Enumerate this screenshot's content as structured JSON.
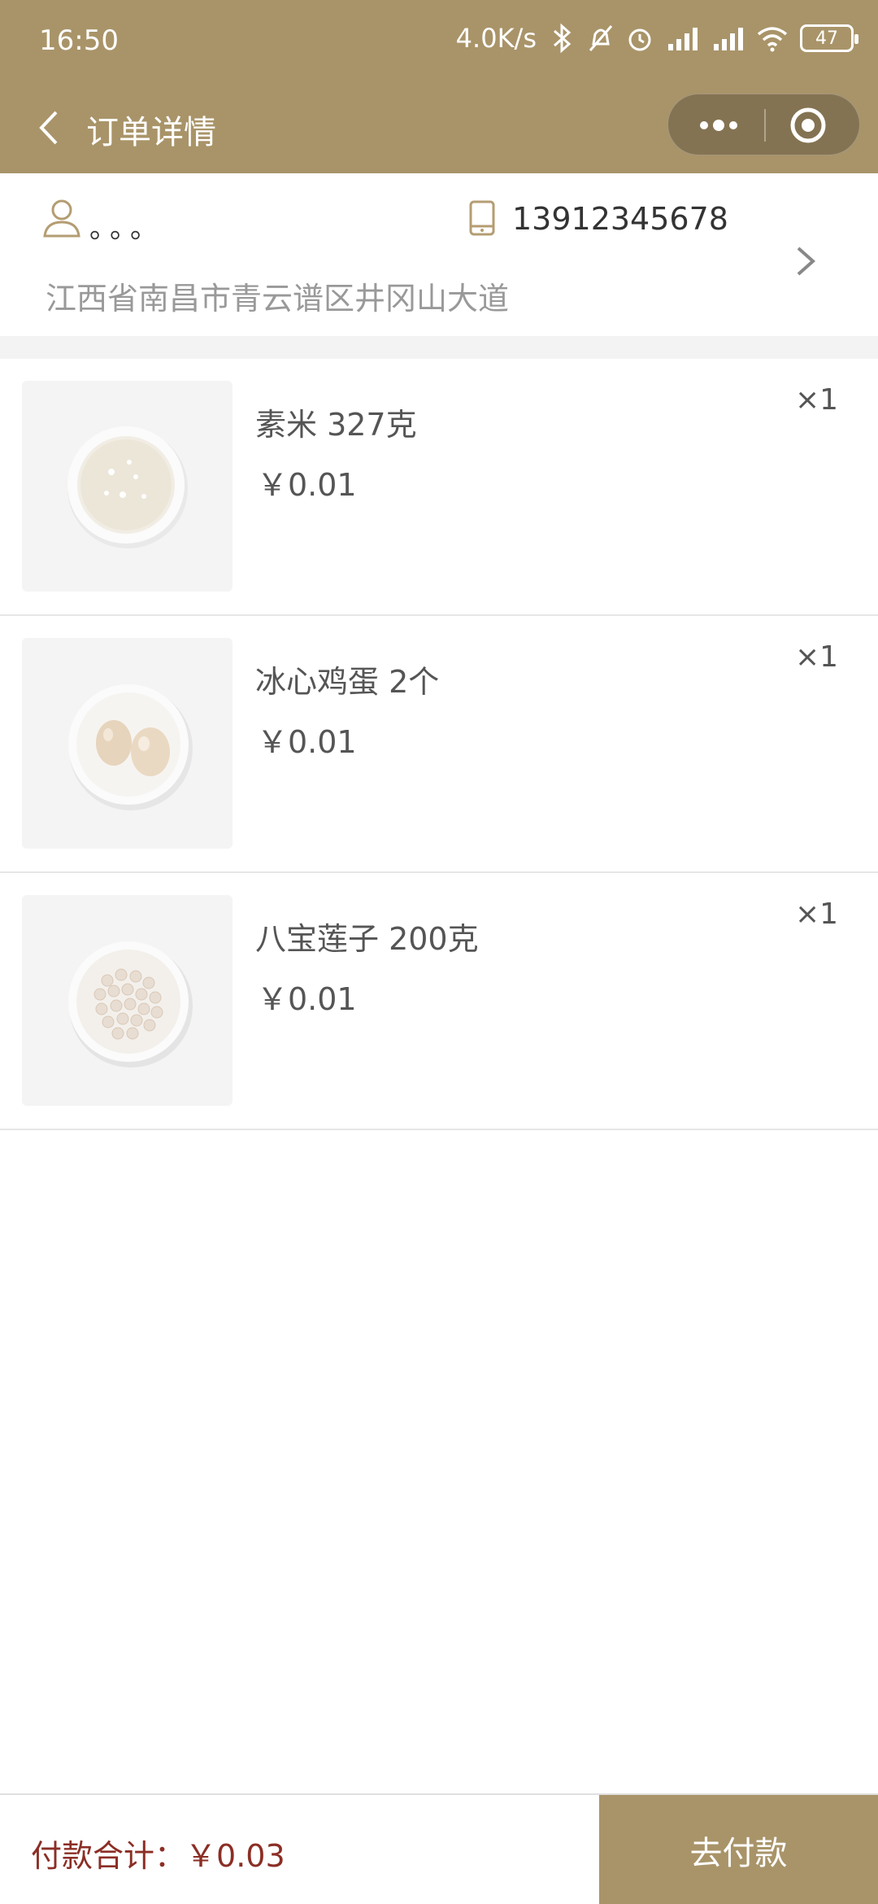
{
  "status_bar": {
    "time": "16:50",
    "net_speed": "4.0K/s",
    "battery": "47",
    "icons": [
      "bluetooth-icon",
      "mute-icon",
      "alarm-icon",
      "hd-signal-icon",
      "hd-signal-icon",
      "wifi-icon",
      "battery-icon"
    ]
  },
  "nav": {
    "title": "订单详情",
    "back_icon": "chevron-left-icon",
    "menu_icon": "more-dots-icon",
    "close_icon": "target-circle-icon"
  },
  "address": {
    "name": "。。。",
    "phone": "13912345678",
    "address": "江西省南昌市青云谱区井冈山大道",
    "user_icon": "user-icon",
    "phone_icon": "phone-icon",
    "arrow_icon": "chevron-right-icon"
  },
  "items": [
    {
      "name": "素米 327克",
      "price": "￥0.01",
      "qty": "×1",
      "image": "rice-plate"
    },
    {
      "name": "冰心鸡蛋 2个",
      "price": "￥0.01",
      "qty": "×1",
      "image": "eggs-plate"
    },
    {
      "name": "八宝莲子 200克",
      "price": "￥0.01",
      "qty": "×1",
      "image": "lotus-seeds-plate"
    }
  ],
  "footer": {
    "total_label": "付款合计：",
    "total_amount": "￥0.03",
    "pay_button": "去付款"
  },
  "colors": {
    "brand": "#A99469",
    "price_red": "#8B2E25",
    "divider": "#e6e6e6"
  }
}
